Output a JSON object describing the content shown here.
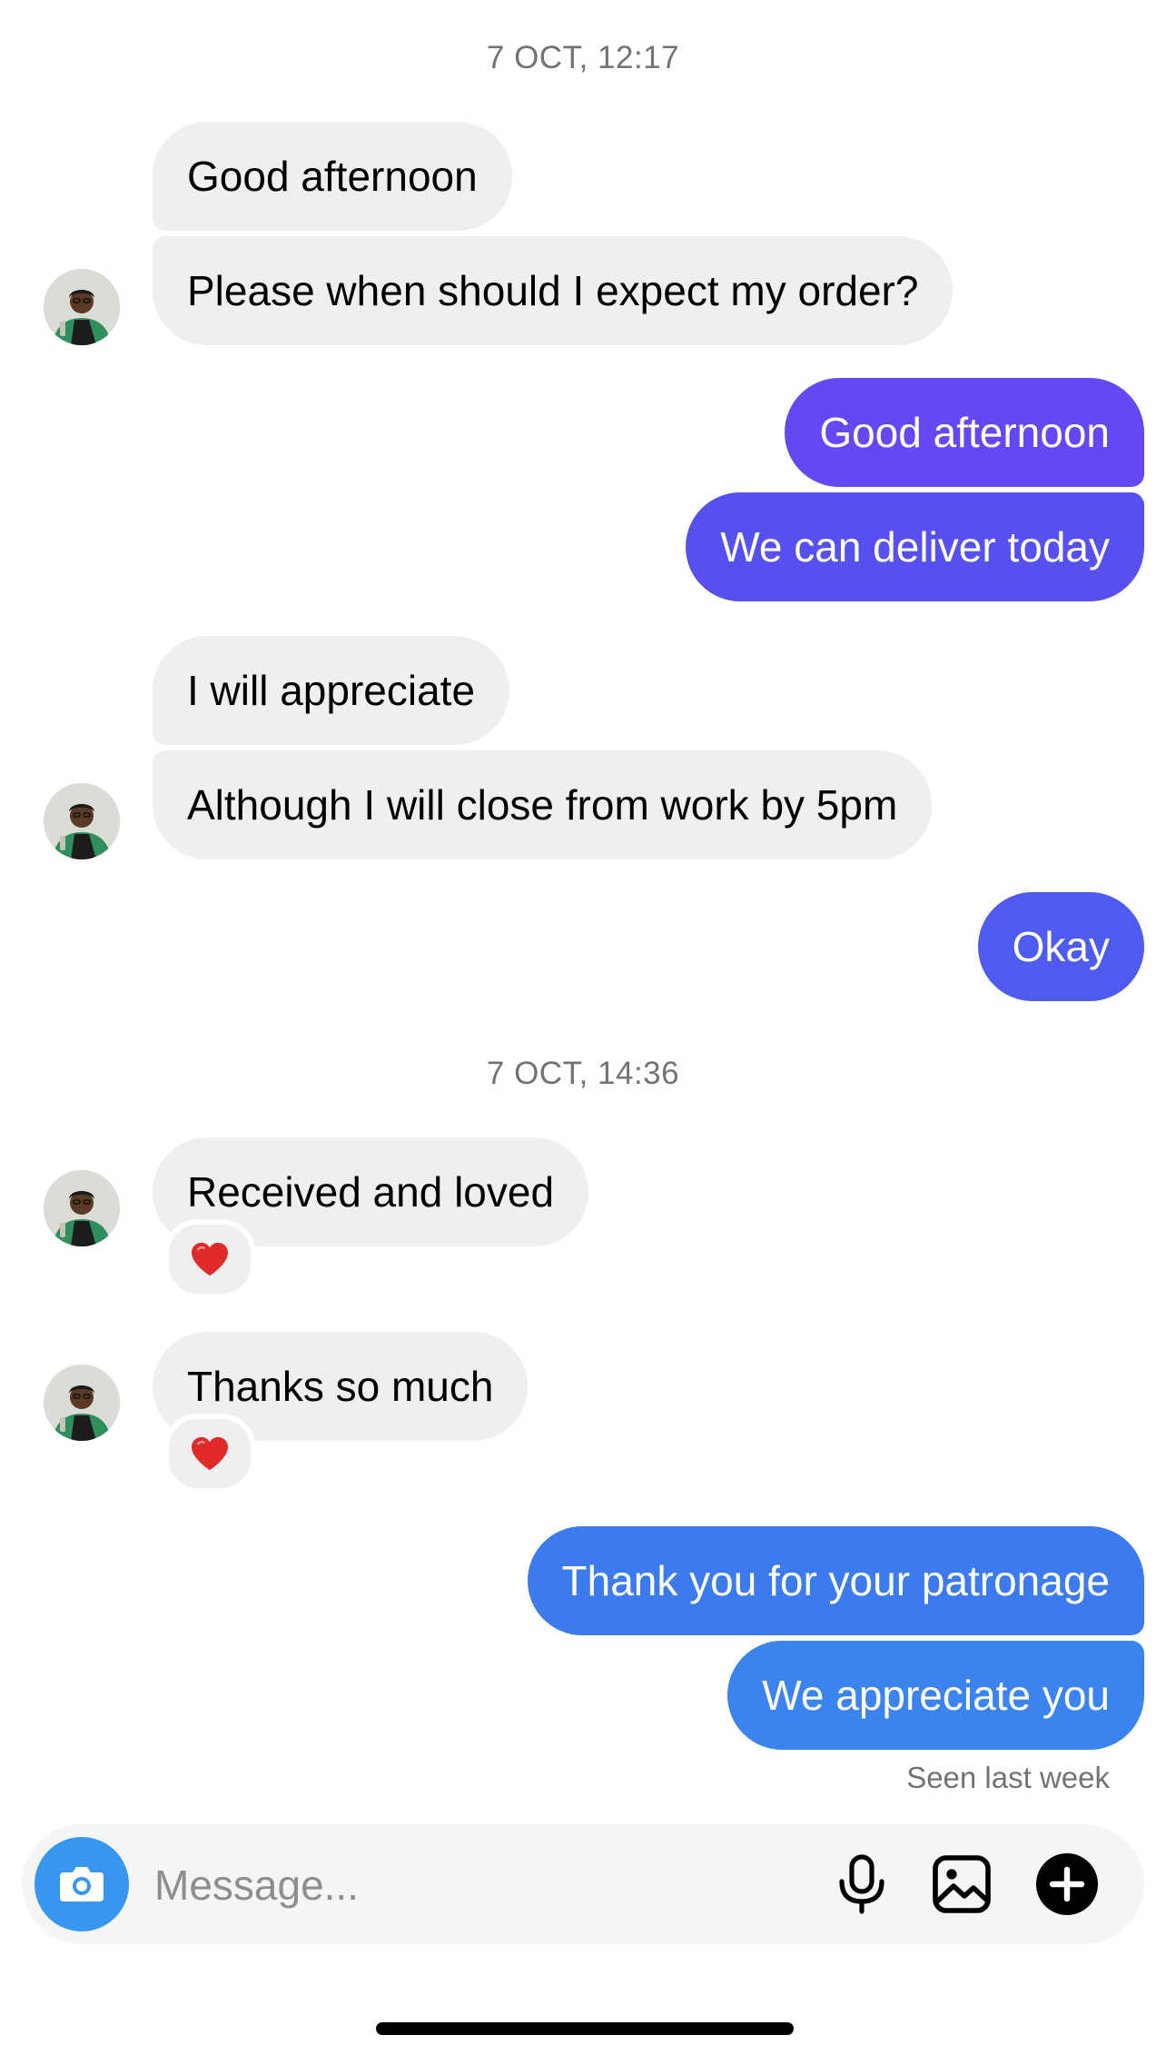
{
  "timestamps": [
    "7 OCT, 12:17",
    "7 OCT, 14:36"
  ],
  "messages": {
    "m1": "Good afternoon",
    "m2": "Please when should I expect my order?",
    "m3": "Good afternoon",
    "m4": "We can deliver today",
    "m5": "I will appreciate",
    "m6": "Although I will close from work by 5pm",
    "m7": "Okay",
    "m8": "Received and loved",
    "m9": "Thanks so much",
    "m10": "Thank you for your patronage",
    "m11": "We appreciate you"
  },
  "reactions": {
    "m8": "heart-icon",
    "m9": "heart-icon"
  },
  "seen_status": "Seen last week",
  "composer": {
    "placeholder": "Message...",
    "icons": [
      "camera-icon",
      "microphone-icon",
      "gallery-icon",
      "add-icon"
    ]
  },
  "colors": {
    "incoming_bubble": "#efefef",
    "outgoing_gradient": [
      "#6449f2",
      "#4f55ee",
      "#4466ee",
      "#3c7bee",
      "#3b83ee"
    ],
    "camera_button": "#3797f0",
    "reaction_heart": "#e02a2a"
  }
}
